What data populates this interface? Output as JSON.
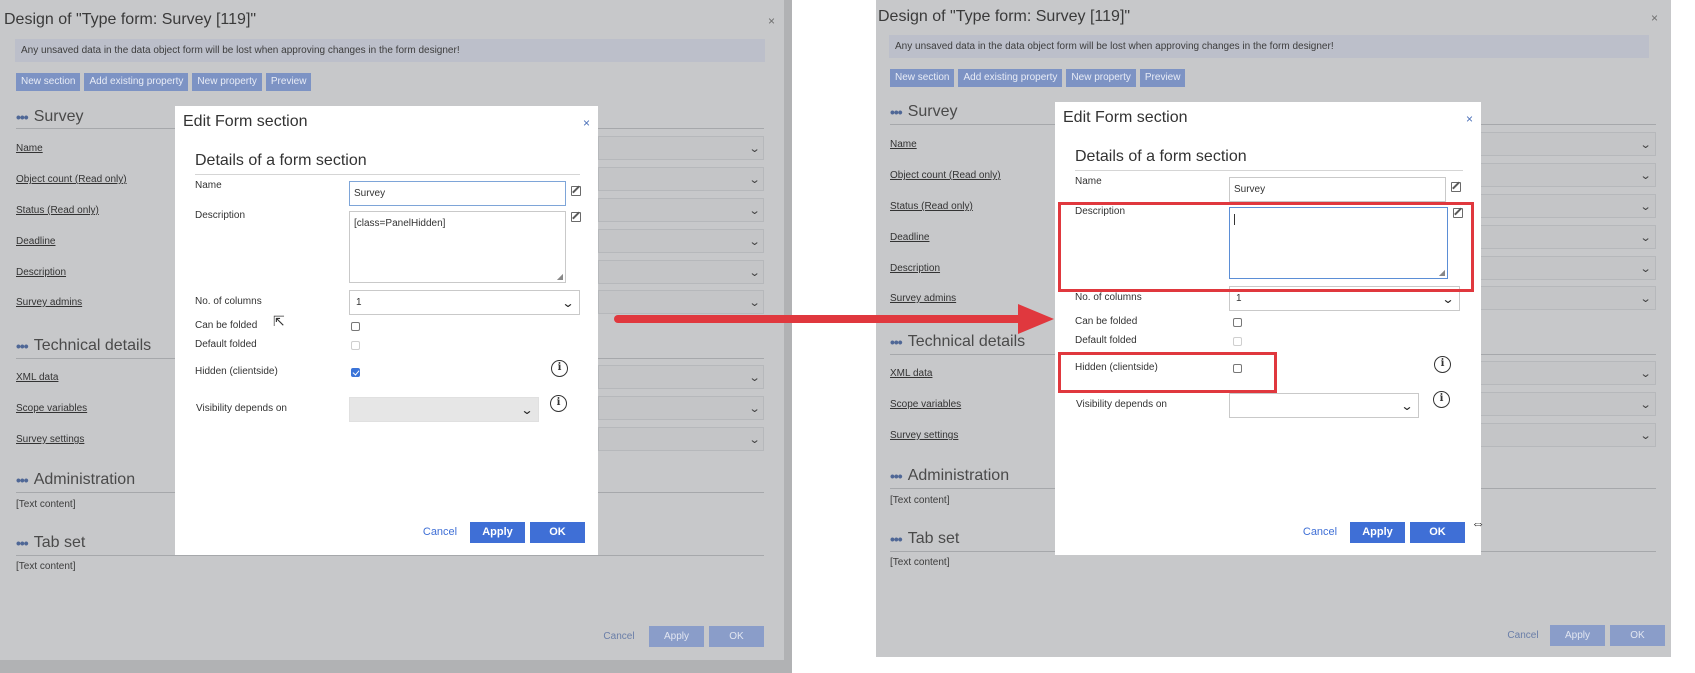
{
  "designer": {
    "title": "Design of \"Type form: Survey [119]\"",
    "close": "×",
    "notice": "Any unsaved data in the data object form will be lost when approving changes in the form designer!",
    "toolbar": [
      "New section",
      "Add existing property",
      "New property",
      "Preview"
    ],
    "sections": {
      "survey": "Survey",
      "technical": "Technical details",
      "administration": "Administration",
      "tabset": "Tab set"
    },
    "survey_props": [
      "Name",
      "Object count (Read only)",
      "Status (Read only)",
      "Deadline",
      "Description",
      "Survey admins"
    ],
    "technical_props": [
      "XML data",
      "Scope variables",
      "Survey settings"
    ],
    "text_content": "[Text content]",
    "bottom": {
      "cancel": "Cancel",
      "apply": "Apply",
      "ok": "OK"
    }
  },
  "dialog_before": {
    "title": "Edit Form section",
    "close": "×",
    "subtitle": "Details of a form section",
    "labels": {
      "name": "Name",
      "description": "Description",
      "columns": "No. of columns",
      "foldable": "Can be folded",
      "default_folded": "Default folded",
      "hidden": "Hidden (clientside)",
      "visibility": "Visibility depends on"
    },
    "name_value": "Survey",
    "description_value": "[class=PanelHidden]",
    "columns_value": "1",
    "hidden_checked": true,
    "buttons": {
      "cancel": "Cancel",
      "apply": "Apply",
      "ok": "OK"
    }
  },
  "dialog_after": {
    "title": "Edit Form section",
    "close": "×",
    "subtitle": "Details of a form section",
    "labels": {
      "name": "Name",
      "description": "Description",
      "columns": "No. of columns",
      "foldable": "Can be folded",
      "default_folded": "Default folded",
      "hidden": "Hidden (clientside)",
      "visibility": "Visibility depends on"
    },
    "name_value": "Survey",
    "description_value": "",
    "columns_value": "1",
    "hidden_checked": false,
    "buttons": {
      "cancel": "Cancel",
      "apply": "Apply",
      "ok": "OK"
    }
  },
  "colors": {
    "highlight": "#e0383e",
    "arrow": "#e0383e",
    "primary_button": "#3f6fd6",
    "overlay": "#c7c8ca"
  },
  "icons": {
    "edit": "edit-icon",
    "info": "info-icon",
    "chevron": "chevron-down-icon",
    "close": "close-icon",
    "cursor": "mouse-cursor-icon",
    "resize_cursor": "resize-cursor-icon"
  }
}
